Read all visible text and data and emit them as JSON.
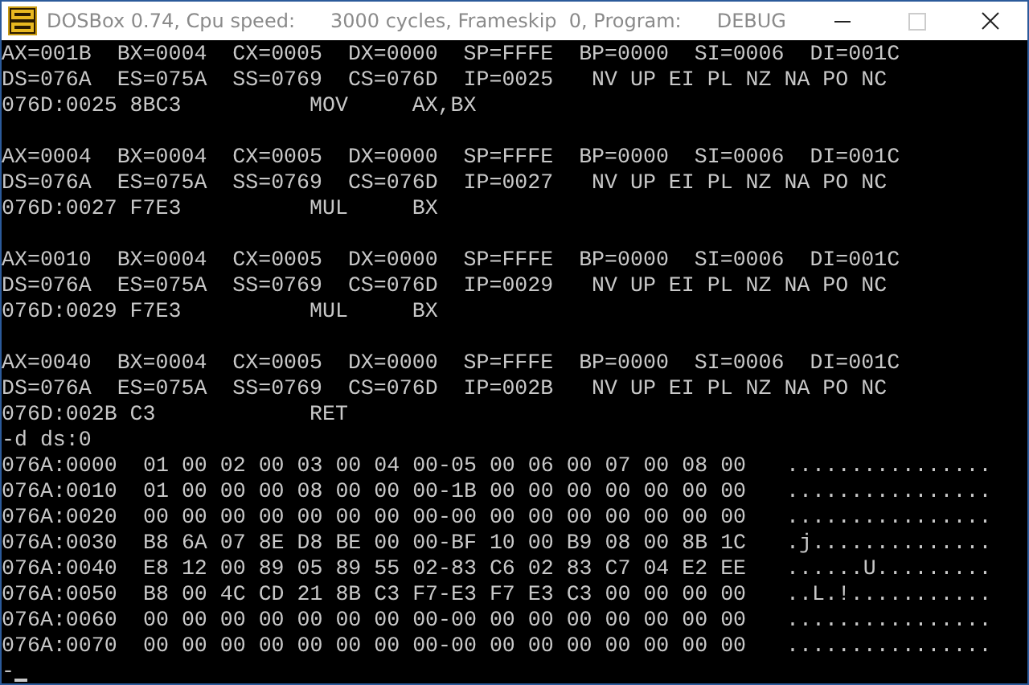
{
  "window": {
    "title_segments": [
      "DOSBox 0.74, Cpu speed:",
      "3000 cycles, Frameskip  0, Program:",
      "DEBUG"
    ],
    "maximize_disabled": true
  },
  "trace_steps": [
    {
      "registers": "AX=001B  BX=0004  CX=0005  DX=0000  SP=FFFE  BP=0000  SI=0006  DI=001C",
      "segments": "DS=076A  ES=075A  SS=0769  CS=076D  IP=0025   NV UP EI PL NZ NA PO NC",
      "instruction": "076D:0025 8BC3          MOV     AX,BX"
    },
    {
      "registers": "AX=0004  BX=0004  CX=0005  DX=0000  SP=FFFE  BP=0000  SI=0006  DI=001C",
      "segments": "DS=076A  ES=075A  SS=0769  CS=076D  IP=0027   NV UP EI PL NZ NA PO NC",
      "instruction": "076D:0027 F7E3          MUL     BX"
    },
    {
      "registers": "AX=0010  BX=0004  CX=0005  DX=0000  SP=FFFE  BP=0000  SI=0006  DI=001C",
      "segments": "DS=076A  ES=075A  SS=0769  CS=076D  IP=0029   NV UP EI PL NZ NA PO NC",
      "instruction": "076D:0029 F7E3          MUL     BX"
    },
    {
      "registers": "AX=0040  BX=0004  CX=0005  DX=0000  SP=FFFE  BP=0000  SI=0006  DI=001C",
      "segments": "DS=076A  ES=075A  SS=0769  CS=076D  IP=002B   NV UP EI PL NZ NA PO NC",
      "instruction": "076D:002B C3            RET"
    }
  ],
  "command": "-d ds:0",
  "dump": [
    {
      "address": "076A:0000",
      "bytes": "01 00 02 00 03 00 04 00-05 00 06 00 07 00 08 00",
      "ascii": "................"
    },
    {
      "address": "076A:0010",
      "bytes": "01 00 00 00 08 00 00 00-1B 00 00 00 00 00 00 00",
      "ascii": "................"
    },
    {
      "address": "076A:0020",
      "bytes": "00 00 00 00 00 00 00 00-00 00 00 00 00 00 00 00",
      "ascii": "................"
    },
    {
      "address": "076A:0030",
      "bytes": "B8 6A 07 8E D8 BE 00 00-BF 10 00 B9 08 00 8B 1C",
      "ascii": ".j.............."
    },
    {
      "address": "076A:0040",
      "bytes": "E8 12 00 89 05 89 55 02-83 C6 02 83 C7 04 E2 EE",
      "ascii": "......U........."
    },
    {
      "address": "076A:0050",
      "bytes": "B8 00 4C CD 21 8B C3 F7-E3 F7 E3 C3 00 00 00 00",
      "ascii": "..L.!..........."
    },
    {
      "address": "076A:0060",
      "bytes": "00 00 00 00 00 00 00 00-00 00 00 00 00 00 00 00",
      "ascii": "................"
    },
    {
      "address": "076A:0070",
      "bytes": "00 00 00 00 00 00 00 00-00 00 00 00 00 00 00 00",
      "ascii": "................"
    }
  ],
  "prompt": "-"
}
